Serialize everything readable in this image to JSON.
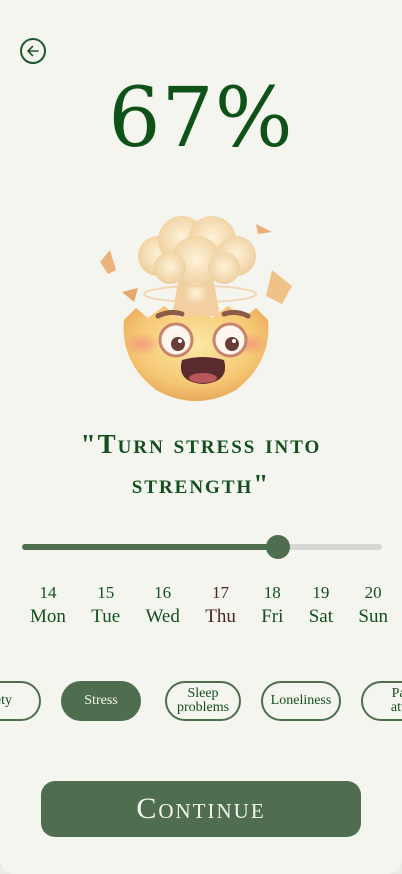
{
  "progress": {
    "percent_label": "67%"
  },
  "emoji": {
    "name": "exploding-head-icon"
  },
  "quote": "\"Turn stress into strength\"",
  "slider": {
    "value": 0.71
  },
  "days": [
    {
      "num": "14",
      "name": "Mon"
    },
    {
      "num": "15",
      "name": "Tue"
    },
    {
      "num": "16",
      "name": "Wed"
    },
    {
      "num": "17",
      "name": "Thu",
      "current": true
    },
    {
      "num": "18",
      "name": "Fri"
    },
    {
      "num": "19",
      "name": "Sat"
    },
    {
      "num": "20",
      "name": "Sun"
    }
  ],
  "chips": [
    {
      "label": "iety",
      "active": false
    },
    {
      "label": "Stress",
      "active": true
    },
    {
      "label": "Sleep\nproblems",
      "active": false
    },
    {
      "label": "Loneliness",
      "active": false
    },
    {
      "label": "Par\natta",
      "active": false
    }
  ],
  "continue_label": "Continue",
  "colors": {
    "accent": "#4f6e4f",
    "title": "#0f5219",
    "background": "#f5f5ef"
  }
}
